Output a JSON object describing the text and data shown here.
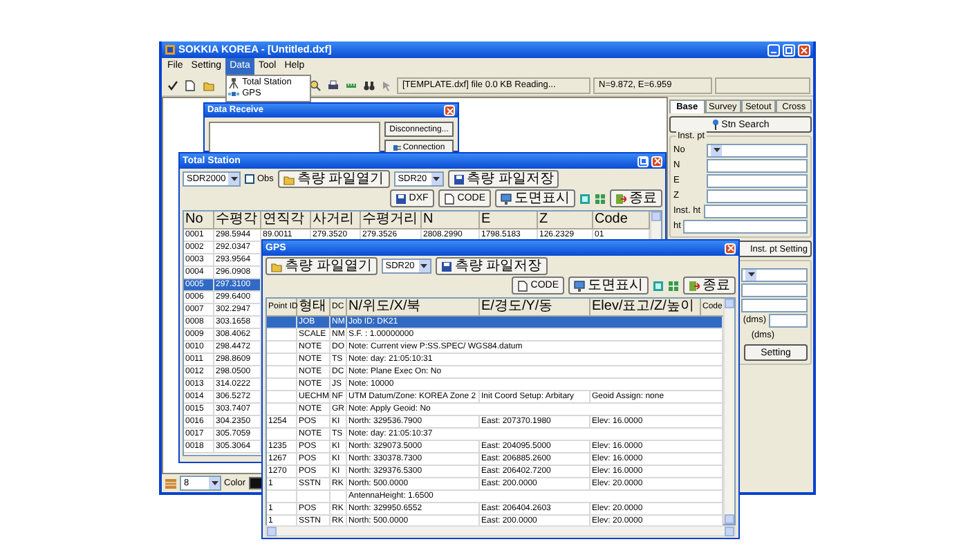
{
  "window": {
    "title": "SOKKIA KOREA - [Untitled.dxf]"
  },
  "menu": [
    {
      "label": "File",
      "selected": false
    },
    {
      "label": "Setting",
      "selected": false
    },
    {
      "label": "Data",
      "selected": true
    },
    {
      "label": "Tool",
      "selected": false
    },
    {
      "label": "Help",
      "selected": false
    }
  ],
  "data_menu": [
    {
      "label": "Total Station",
      "kind": "station"
    },
    {
      "label": "GPS",
      "kind": "gps"
    }
  ],
  "toolbar": {
    "status": "[TEMPLATE.dxf] file 0.0 KB Reading...",
    "coords": "N=9.872, E=6.959"
  },
  "side_panel": {
    "tabs": [
      {
        "label": "Base",
        "selected": true
      },
      {
        "label": "Survey",
        "selected": false
      },
      {
        "label": "Setout",
        "selected": false
      },
      {
        "label": "Cross",
        "selected": false
      }
    ],
    "search_button": "Stn Search",
    "group_title": "Inst. pt",
    "fields": [
      {
        "label": "No",
        "kind": "combo"
      },
      {
        "label": "N",
        "kind": "text"
      },
      {
        "label": "E",
        "kind": "text"
      },
      {
        "label": "Z",
        "kind": "text"
      },
      {
        "label": "Inst. ht",
        "kind": "text"
      },
      {
        "label": "ht",
        "kind": "text"
      }
    ],
    "setting_button": "Inst. pt Setting",
    "lower_fields": [
      {
        "kind": "combo"
      },
      {
        "kind": "text"
      },
      {
        "kind": "text"
      },
      {
        "kind": "text",
        "label": "(dms)"
      },
      {
        "kind": "note",
        "label": "(dms)"
      }
    ],
    "apply_button": "Setting"
  },
  "data_receive": {
    "title": "Data Receive",
    "buttons": [
      {
        "label": "Disconnecting...",
        "kind": "plain"
      },
      {
        "label": "Connection",
        "kind": "icon"
      }
    ]
  },
  "total_station": {
    "title": "Total Station",
    "device": "SDR2000",
    "obs": {
      "label": "Obs",
      "checked": false
    },
    "open_button": "측량 파일열기",
    "format": "SDR20",
    "save_button": "측량 파일저장",
    "tools": [
      {
        "kind": "disk",
        "label": "DXF"
      },
      {
        "kind": "doc",
        "label": "CODE"
      },
      {
        "kind": "monitor",
        "label": "도면표시"
      }
    ],
    "close_button": "종료",
    "columns": [
      "No",
      "수평각",
      "연직각",
      "사거리",
      "수평거리",
      "N",
      "E",
      "Z",
      "Code"
    ],
    "rows": [
      {
        "cells": [
          "0001",
          "298.5944",
          "89.0011",
          "279.3520",
          "279.3526",
          "2808.2990",
          "1798.5183",
          "126.2329",
          "01"
        ],
        "selected": false
      },
      {
        "cells": [
          "0002",
          "292.0347"
        ],
        "selected": false
      },
      {
        "cells": [
          "0003",
          "293.9564"
        ],
        "selected": false
      },
      {
        "cells": [
          "0004",
          "296.0908"
        ],
        "selected": false
      },
      {
        "cells": [
          "0005",
          "297.3100"
        ],
        "selected": true
      },
      {
        "cells": [
          "0006",
          "299.6400"
        ],
        "selected": false
      },
      {
        "cells": [
          "0007",
          "302.2947"
        ],
        "selected": false
      },
      {
        "cells": [
          "0008",
          "303.1658"
        ],
        "selected": false
      },
      {
        "cells": [
          "0009",
          "308.4062"
        ],
        "selected": false
      },
      {
        "cells": [
          "0010",
          "298.4472"
        ],
        "selected": false
      },
      {
        "cells": [
          "0011",
          "298.8609"
        ],
        "selected": false
      },
      {
        "cells": [
          "0012",
          "298.0500"
        ],
        "selected": false
      },
      {
        "cells": [
          "0013",
          "314.0222"
        ],
        "selected": false
      },
      {
        "cells": [
          "0014",
          "306.5272"
        ],
        "selected": false
      },
      {
        "cells": [
          "0015",
          "303.7407"
        ],
        "selected": false
      },
      {
        "cells": [
          "0016",
          "304.2350"
        ],
        "selected": false
      },
      {
        "cells": [
          "0017",
          "305.7059"
        ],
        "selected": false
      },
      {
        "cells": [
          "0018",
          "305.3064"
        ],
        "selected": false
      }
    ]
  },
  "gps": {
    "title": "GPS",
    "open_button": "측량 파일열기",
    "format": "SDR20",
    "save_button": "측량 파일저장",
    "tools": [
      {
        "kind": "doc",
        "label": "CODE"
      },
      {
        "kind": "monitor",
        "label": "도면표시"
      }
    ],
    "close_button": "종료",
    "columns": [
      "Point ID",
      "형태",
      "DC",
      "N/위도/X/북",
      "E/경도/Y/동",
      "Elev/표고/Z/높이",
      "Code"
    ],
    "rows": [
      {
        "type": "JOB",
        "dc": "NM",
        "n": "Job ID: DK21",
        "selected": true
      },
      {
        "type": "SCALE",
        "dc": "NM",
        "n": "S.F. : 1.00000000",
        "selected": false
      },
      {
        "type": "NOTE",
        "dc": "DO",
        "n": "Note: Current view P:SS.SPEC/ WGS84.datum",
        "selected": false
      },
      {
        "type": "NOTE",
        "dc": "TS",
        "n": "Note: day: 21:05:10:31",
        "selected": false
      },
      {
        "type": "NOTE",
        "dc": "DC",
        "n": "Note: Plane Exec On: No",
        "selected": false
      },
      {
        "type": "NOTE",
        "dc": "JS",
        "n": "Note: 10000",
        "selected": false
      },
      {
        "type": "UECHM",
        "dc": "NF",
        "n": "UTM Datum/Zone: KOREA Zone 2",
        "e": "Init Coord Setup: Arbitary",
        "elev": "Geoid Assign: none",
        "selected": false
      },
      {
        "type": "NOTE",
        "dc": "GR",
        "n": "Note: Apply Geoid: No",
        "selected": false
      },
      {
        "id": "1254",
        "type": "POS",
        "dc": "KI",
        "n": "North: 329536.7900",
        "e": "East: 207370.1980",
        "elev": "Elev: 16.0000",
        "selected": false
      },
      {
        "type": "NOTE",
        "dc": "TS",
        "n": "Note: day: 21:05:10:37",
        "selected": false
      },
      {
        "id": "1235",
        "type": "POS",
        "dc": "KI",
        "n": "North: 329073.5000",
        "e": "East: 204095.5000",
        "elev": "Elev: 16.0000",
        "selected": false
      },
      {
        "id": "1267",
        "type": "POS",
        "dc": "KI",
        "n": "North: 330378.7300",
        "e": "East: 206885.2600",
        "elev": "Elev: 16.0000",
        "selected": false
      },
      {
        "id": "1270",
        "type": "POS",
        "dc": "KI",
        "n": "North: 329376.5300",
        "e": "East: 206402.7200",
        "elev": "Elev: 16.0000",
        "selected": false
      },
      {
        "id": "1",
        "type": "SSTN",
        "dc": "RK",
        "n": "North: 500.0000",
        "e": "East: 200.0000",
        "elev": "Elev: 20.0000",
        "selected": false
      },
      {
        "n": "AntennaHeight: 1.6500",
        "selected": false
      },
      {
        "id": "1",
        "type": "POS",
        "dc": "RK",
        "n": "North: 329950.6552",
        "e": "East: 206404.2603",
        "elev": "Elev: 20.0000",
        "selected": false
      },
      {
        "id": "1",
        "type": "SSTN",
        "dc": "RK",
        "n": "North: 500.0000",
        "e": "East: 200.0000",
        "elev": "Elev: 20.0000",
        "selected": false
      }
    ]
  },
  "bottom_bar": {
    "layer": "8",
    "color_label": "Color"
  }
}
